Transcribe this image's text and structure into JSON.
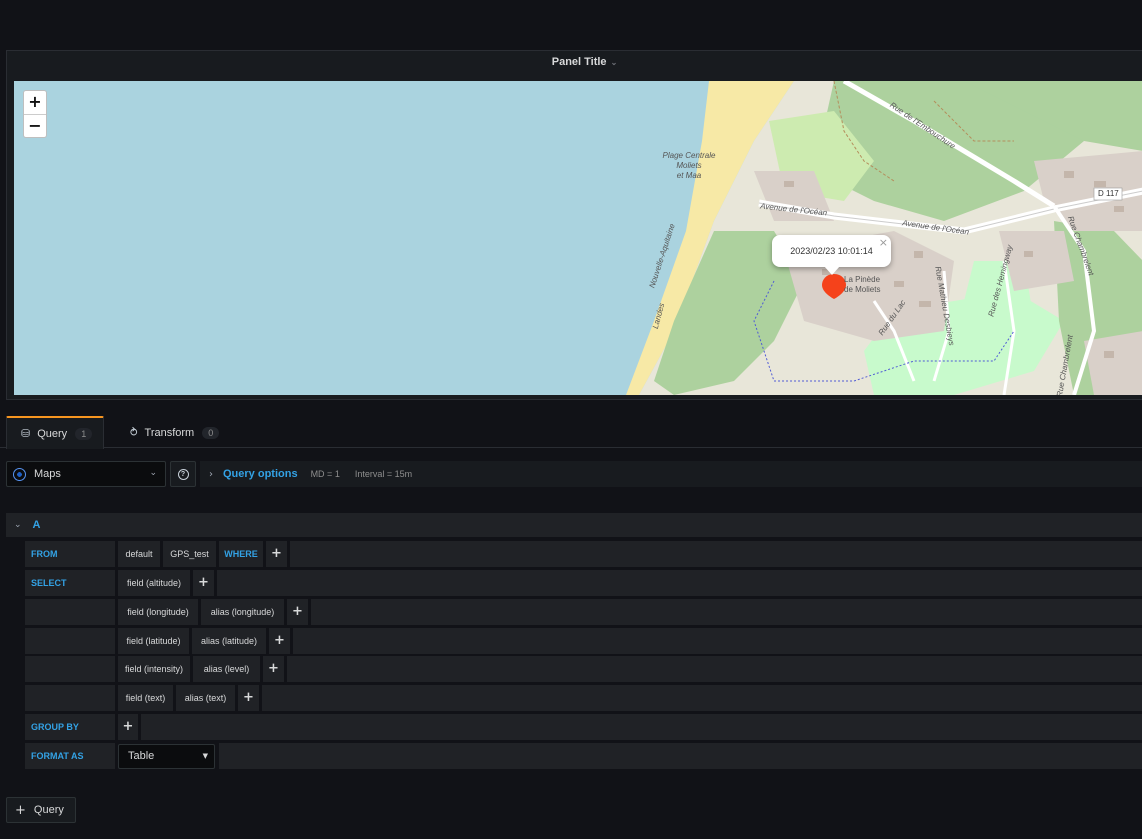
{
  "panel": {
    "title": "Panel Title",
    "title_caret": "⌄",
    "map": {
      "zoom_in": "+",
      "zoom_out": "−",
      "popup_time": "2023/02/23 10:01:14",
      "popup_close": "×",
      "labels": {
        "beach": "Plage Centrale\nMoliets\net Maa",
        "ocean_ave_1": "Avenue de l'Océan",
        "ocean_ave_2": "Avenue de l'Océan",
        "embouchure": "Rue de l'Embouchure",
        "d117": "D 117",
        "pinede": "La Pinède\nde Moliets",
        "nouvelle_aquitaine": "Nouvelle-Aquitaine",
        "landes": "Landes",
        "chambrelent_1": "Rue Chambrelent",
        "chambrelent_2": "Rue Chambrelent",
        "hemingway": "Rue des Hemingway",
        "mathieu": "Rue Mathieu Desbieys",
        "rue_du_lac": "Rue du Lac"
      },
      "colors": {
        "sea": "#aad3df",
        "beach": "#f7e9a6",
        "forest": "#add19e",
        "park": "#c8facc",
        "urban": "#d9d0c9",
        "marker": "#f5421b"
      }
    }
  },
  "tabs": [
    {
      "label": "Query",
      "count": "1",
      "icon": "database-icon"
    },
    {
      "label": "Transform",
      "count": "0",
      "icon": "transform-icon"
    }
  ],
  "datasource": {
    "name": "Maps",
    "help_icon": "?",
    "query_options_label": "Query options",
    "md": "MD = 1",
    "interval": "Interval = 15m"
  },
  "query": {
    "ref_id": "A",
    "from": {
      "label": "FROM",
      "policy": "default",
      "measurement": "GPS_test",
      "where": "WHERE",
      "plus": "+"
    },
    "select": {
      "label": "SELECT",
      "rows": [
        {
          "field": "field (altitude)",
          "alias": ""
        },
        {
          "field": "field (longitude)",
          "alias": "alias (longitude)"
        },
        {
          "field": "field (latitude)",
          "alias": "alias (latitude)"
        },
        {
          "field": "field (intensity)",
          "alias": "alias (level)"
        },
        {
          "field": "field (text)",
          "alias": "alias (text)"
        }
      ],
      "plus": "+"
    },
    "group_by": {
      "label": "GROUP BY",
      "plus": "+"
    },
    "format_as": {
      "label": "FORMAT AS",
      "value": "Table"
    }
  },
  "add_query": {
    "label": "Query",
    "plus": "+"
  }
}
